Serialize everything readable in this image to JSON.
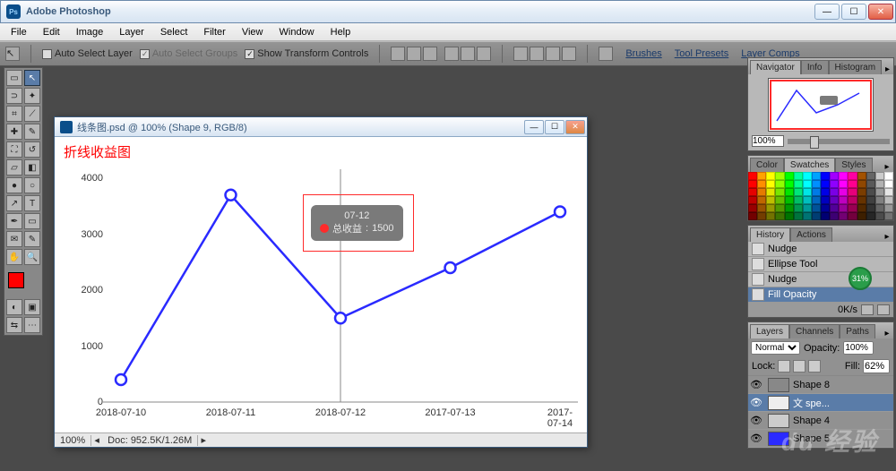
{
  "titlebar": {
    "app_name": "Adobe Photoshop"
  },
  "menu": {
    "items": [
      "File",
      "Edit",
      "Image",
      "Layer",
      "Select",
      "Filter",
      "View",
      "Window",
      "Help"
    ]
  },
  "options_bar": {
    "auto_select_layer": "Auto Select Layer",
    "auto_select_groups": "Auto Select Groups",
    "show_transform": "Show Transform Controls",
    "tab_brushes": "Brushes",
    "tab_tool_presets": "Tool Presets",
    "tab_layer_comps": "Layer Comps"
  },
  "doc": {
    "title": "线条图.psd @ 100% (Shape 9, RGB/8)",
    "status_zoom": "100%",
    "status_doc": "Doc: 952.5K/1.26M"
  },
  "chart_data": {
    "type": "line",
    "title": "折线收益图",
    "categories": [
      "2018-07-10",
      "2018-07-11",
      "2018-07-12",
      "2017-07-13",
      "2017-07-14"
    ],
    "values": [
      400,
      3700,
      1500,
      2400,
      3400
    ],
    "xlabel": "",
    "ylabel": "",
    "ylim": [
      0,
      4000
    ],
    "yticks": [
      0,
      1000,
      2000,
      3000,
      4000
    ],
    "tooltip": {
      "date": "07-12",
      "series_label": "总收益",
      "value": 1500
    },
    "accent_color": "#2a2aff",
    "highlight_color": "#ff2a2a"
  },
  "panels": {
    "navigator": {
      "tabs": [
        "Navigator",
        "Info",
        "Histogram"
      ],
      "zoom": "100%"
    },
    "color": {
      "tabs": [
        "Color",
        "Swatches",
        "Styles"
      ]
    },
    "history": {
      "tabs": [
        "History",
        "Actions"
      ],
      "items": [
        "Nudge",
        "Ellipse Tool",
        "Nudge",
        "Fill Opacity"
      ],
      "selected_index": 3,
      "progress": "31%",
      "rate": "0K/s"
    },
    "layers": {
      "tabs": [
        "Layers",
        "Channels",
        "Paths"
      ],
      "blend_mode": "Normal",
      "opacity_label": "Opacity:",
      "opacity_value": "100%",
      "lock_label": "Lock:",
      "fill_label": "Fill:",
      "fill_value": "62%",
      "items": [
        {
          "name": "Shape 8",
          "thumb": "#888",
          "sel": false
        },
        {
          "name": "文 spe...",
          "thumb": "#eee",
          "sel": true
        },
        {
          "name": "Shape 4",
          "thumb": "#ccc",
          "sel": false
        },
        {
          "name": "Shape 5",
          "thumb": "#2a2aff",
          "sel": false
        }
      ]
    }
  },
  "watermark": "du 经验"
}
